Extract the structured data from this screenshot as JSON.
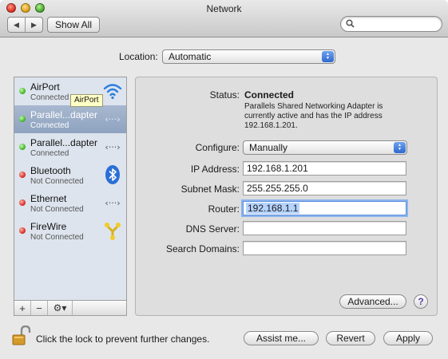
{
  "window": {
    "title": "Network"
  },
  "toolbar": {
    "back_glyph": "◀",
    "forward_glyph": "▶",
    "show_all_label": "Show All",
    "search_placeholder": "",
    "search_value": ""
  },
  "location": {
    "label": "Location:",
    "value": "Automatic"
  },
  "services": [
    {
      "name": "AirPort",
      "status": "Connected",
      "state": "green",
      "icon": "wifi-icon"
    },
    {
      "name": "Parallel...dapter",
      "status": "Connected",
      "state": "green",
      "icon": "ethernet-arrows-icon",
      "selected": true
    },
    {
      "name": "Parallel...dapter",
      "status": "Connected",
      "state": "green",
      "icon": "ethernet-arrows-icon"
    },
    {
      "name": "Bluetooth",
      "status": "Not Connected",
      "state": "red",
      "icon": "bluetooth-icon"
    },
    {
      "name": "Ethernet",
      "status": "Not Connected",
      "state": "red",
      "icon": "ethernet-arrows-icon"
    },
    {
      "name": "FireWire",
      "status": "Not Connected",
      "state": "red",
      "icon": "firewire-icon"
    }
  ],
  "list_controls": {
    "add": "+",
    "remove": "−",
    "gear": "⚙▾"
  },
  "tooltip": {
    "text": "AirPort"
  },
  "details": {
    "status_label": "Status:",
    "status_value": "Connected",
    "status_description": "Parallels Shared Networking Adapter is currently active and has the IP address 192.168.1.201.",
    "configure_label": "Configure:",
    "configure_value": "Manually",
    "ip_label": "IP Address:",
    "ip_value": "192.168.1.201",
    "subnet_label": "Subnet Mask:",
    "subnet_value": "255.255.255.0",
    "router_label": "Router:",
    "router_value": "192.168.1.1",
    "dns_label": "DNS Server:",
    "dns_value": "",
    "search_domains_label": "Search Domains:",
    "search_domains_value": "",
    "advanced_label": "Advanced...",
    "help_glyph": "?"
  },
  "footer": {
    "lock_text": "Click the lock to prevent further changes.",
    "assist_label": "Assist me...",
    "revert_label": "Revert",
    "apply_label": "Apply"
  },
  "colors": {
    "connected": "#35b021",
    "not_connected": "#d1231a",
    "selection": "#8ea3c0",
    "popup_arrow": "#2f68cf"
  }
}
